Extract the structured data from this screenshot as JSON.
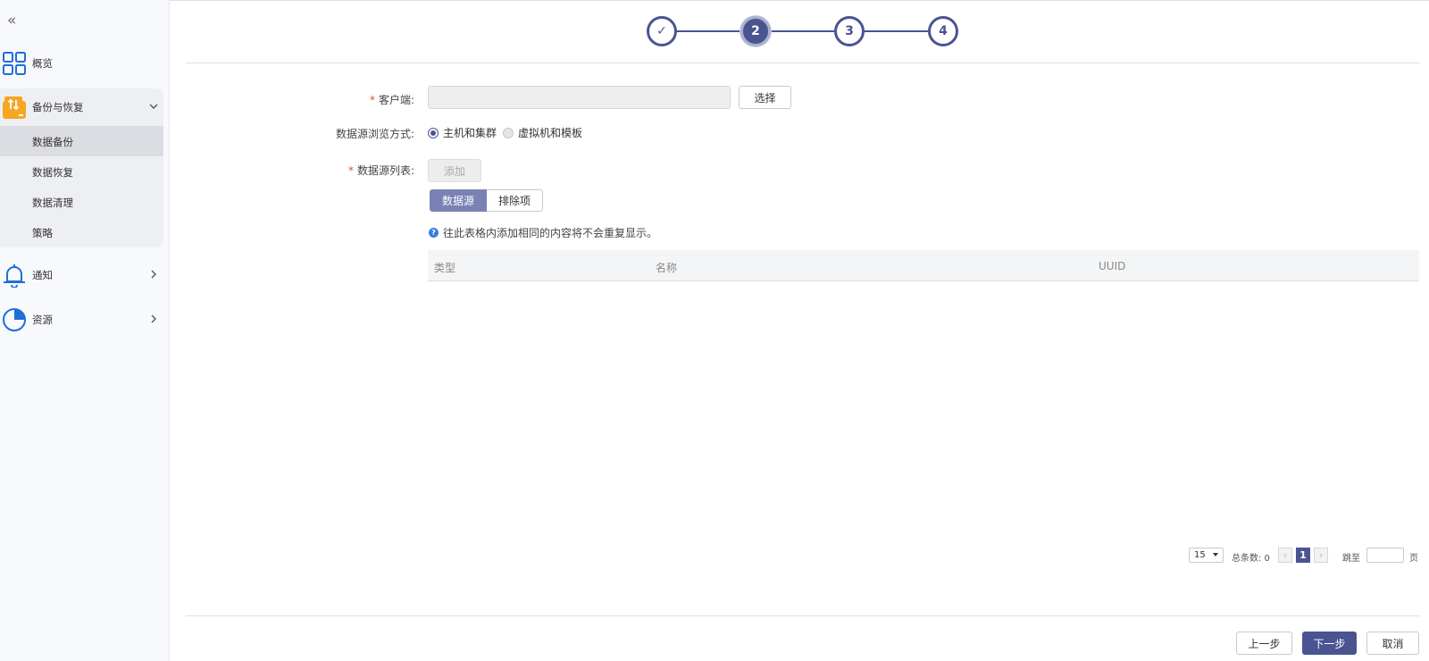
{
  "sidebar": {
    "collapse_glyph": "«",
    "items": [
      {
        "label": "概览",
        "icon": "grid-icon"
      },
      {
        "label": "备份与恢复",
        "icon": "backup-restore-icon",
        "expanded": true,
        "children": [
          {
            "label": "数据备份",
            "active": true
          },
          {
            "label": "数据恢复"
          },
          {
            "label": "数据清理"
          },
          {
            "label": "策略"
          }
        ]
      },
      {
        "label": "通知",
        "icon": "bell-icon"
      },
      {
        "label": "资源",
        "icon": "pie-chart-icon"
      }
    ]
  },
  "stepper": {
    "steps": [
      "✓",
      "2",
      "3",
      "4"
    ],
    "current": 2
  },
  "form": {
    "client_label": "客户端:",
    "client_value": "",
    "select_button": "选择",
    "browse_label": "数据源浏览方式:",
    "browse_options": [
      {
        "label": "主机和集群",
        "checked": true
      },
      {
        "label": "虚拟机和模板",
        "checked": false
      }
    ],
    "source_list_label": "数据源列表:",
    "add_button": "添加",
    "required_mark": "*"
  },
  "tabs": [
    "数据源",
    "排除项"
  ],
  "hint": {
    "icon_glyph": "?",
    "text": "往此表格内添加相同的内容将不会重复显示。"
  },
  "table": {
    "columns": [
      "类型",
      "名称",
      "UUID"
    ],
    "rows": []
  },
  "pagination": {
    "page_size": "15",
    "total_text": "总条数: 0",
    "prev_glyph": "‹",
    "current_page": "1",
    "next_glyph": "›",
    "jump_label": "跳至",
    "page_suffix": "页"
  },
  "footer": {
    "prev_button": "上一步",
    "next_button": "下一步",
    "cancel_button": "取消"
  },
  "colors": {
    "primary": "#4a5491",
    "icon_blue": "#1f6fd6",
    "icon_orange": "#f5a623",
    "required": "#e04b3a"
  }
}
